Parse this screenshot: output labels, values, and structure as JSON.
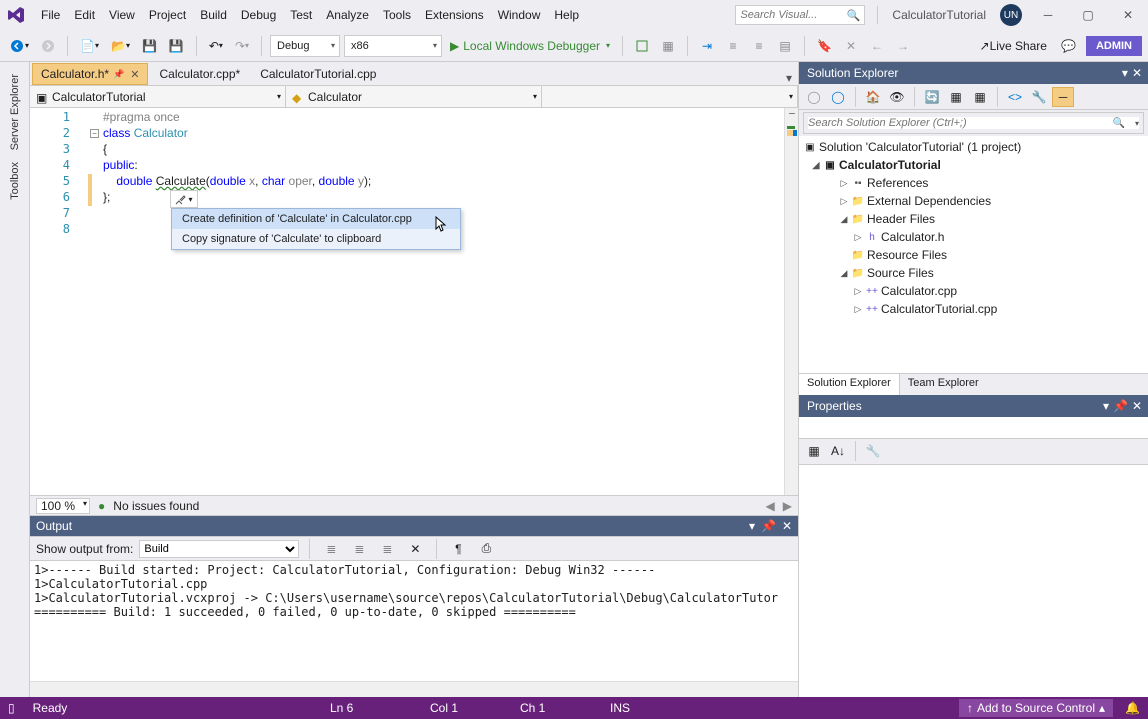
{
  "title_search_placeholder": "Search Visual...",
  "solution_badge": "CalculatorTutorial",
  "avatar": "UN",
  "menus": [
    "File",
    "Edit",
    "View",
    "Project",
    "Build",
    "Debug",
    "Test",
    "Analyze",
    "Tools",
    "Extensions",
    "Window",
    "Help"
  ],
  "toolbar": {
    "config": "Debug",
    "platform": "x86",
    "debug_target": "Local Windows Debugger",
    "live_share": "Live Share",
    "admin": "ADMIN"
  },
  "left_tabs": [
    "Server Explorer",
    "Toolbox"
  ],
  "doc_tabs": [
    {
      "label": "Calculator.h*",
      "active": true,
      "pinned": true
    },
    {
      "label": "Calculator.cpp*",
      "active": false
    },
    {
      "label": "CalculatorTutorial.cpp",
      "active": false
    }
  ],
  "nav": {
    "scope": "CalculatorTutorial",
    "member": "Calculator"
  },
  "code_lines": [
    {
      "n": 1,
      "html": "<span class='k-gray'>#pragma once</span>"
    },
    {
      "n": 2,
      "html": "<span class='k-blue'>class</span> <span class='k-type'>Calculator</span>",
      "collapse": true
    },
    {
      "n": 3,
      "html": "{"
    },
    {
      "n": 4,
      "html": "<span class='k-blue'>public</span>:"
    },
    {
      "n": 5,
      "html": "    <span class='k-blue'>double</span> <span class='k-squiggle'>Calculate</span>(<span class='k-blue'>double</span> <span class='k-gray'>x</span>, <span class='k-blue'>char</span> <span class='k-gray'>oper</span>, <span class='k-blue'>double</span> <span class='k-gray'>y</span>);",
      "mark": true
    },
    {
      "n": 6,
      "html": "};",
      "mark": true
    },
    {
      "n": 7,
      "html": ""
    },
    {
      "n": 8,
      "html": ""
    }
  ],
  "quick_actions": [
    "Create definition of 'Calculate' in Calculator.cpp",
    "Copy signature of 'Calculate' to clipboard"
  ],
  "editor_status": {
    "zoom": "100 %",
    "issues": "No issues found"
  },
  "output": {
    "title": "Output",
    "from_label": "Show output from:",
    "from_value": "Build",
    "text": "1>------ Build started: Project: CalculatorTutorial, Configuration: Debug Win32 ------\n1>CalculatorTutorial.cpp\n1>CalculatorTutorial.vcxproj -> C:\\Users\\username\\source\\repos\\CalculatorTutorial\\Debug\\CalculatorTutor\n========== Build: 1 succeeded, 0 failed, 0 up-to-date, 0 skipped =========="
  },
  "solution_explorer": {
    "title": "Solution Explorer",
    "search_placeholder": "Search Solution Explorer (Ctrl+;)",
    "root": "Solution 'CalculatorTutorial' (1 project)",
    "project": "CalculatorTutorial",
    "nodes": [
      {
        "indent": 2,
        "exp": "▷",
        "ico": "ref",
        "label": "References"
      },
      {
        "indent": 2,
        "exp": "▷",
        "ico": "ext",
        "label": "External Dependencies"
      },
      {
        "indent": 2,
        "exp": "◢",
        "ico": "fld",
        "label": "Header Files"
      },
      {
        "indent": 3,
        "exp": "▷",
        "ico": "h",
        "label": "Calculator.h"
      },
      {
        "indent": 2,
        "exp": "",
        "ico": "fld",
        "label": "Resource Files"
      },
      {
        "indent": 2,
        "exp": "◢",
        "ico": "fld",
        "label": "Source Files"
      },
      {
        "indent": 3,
        "exp": "▷",
        "ico": "cpp",
        "label": "Calculator.cpp"
      },
      {
        "indent": 3,
        "exp": "▷",
        "ico": "cpp",
        "label": "CalculatorTutorial.cpp"
      }
    ],
    "bottom_tabs": [
      "Solution Explorer",
      "Team Explorer"
    ]
  },
  "properties": {
    "title": "Properties"
  },
  "statusbar": {
    "ready": "Ready",
    "ln": "Ln 6",
    "col": "Col 1",
    "ch": "Ch 1",
    "ins": "INS",
    "add_src": "Add to Source Control"
  }
}
